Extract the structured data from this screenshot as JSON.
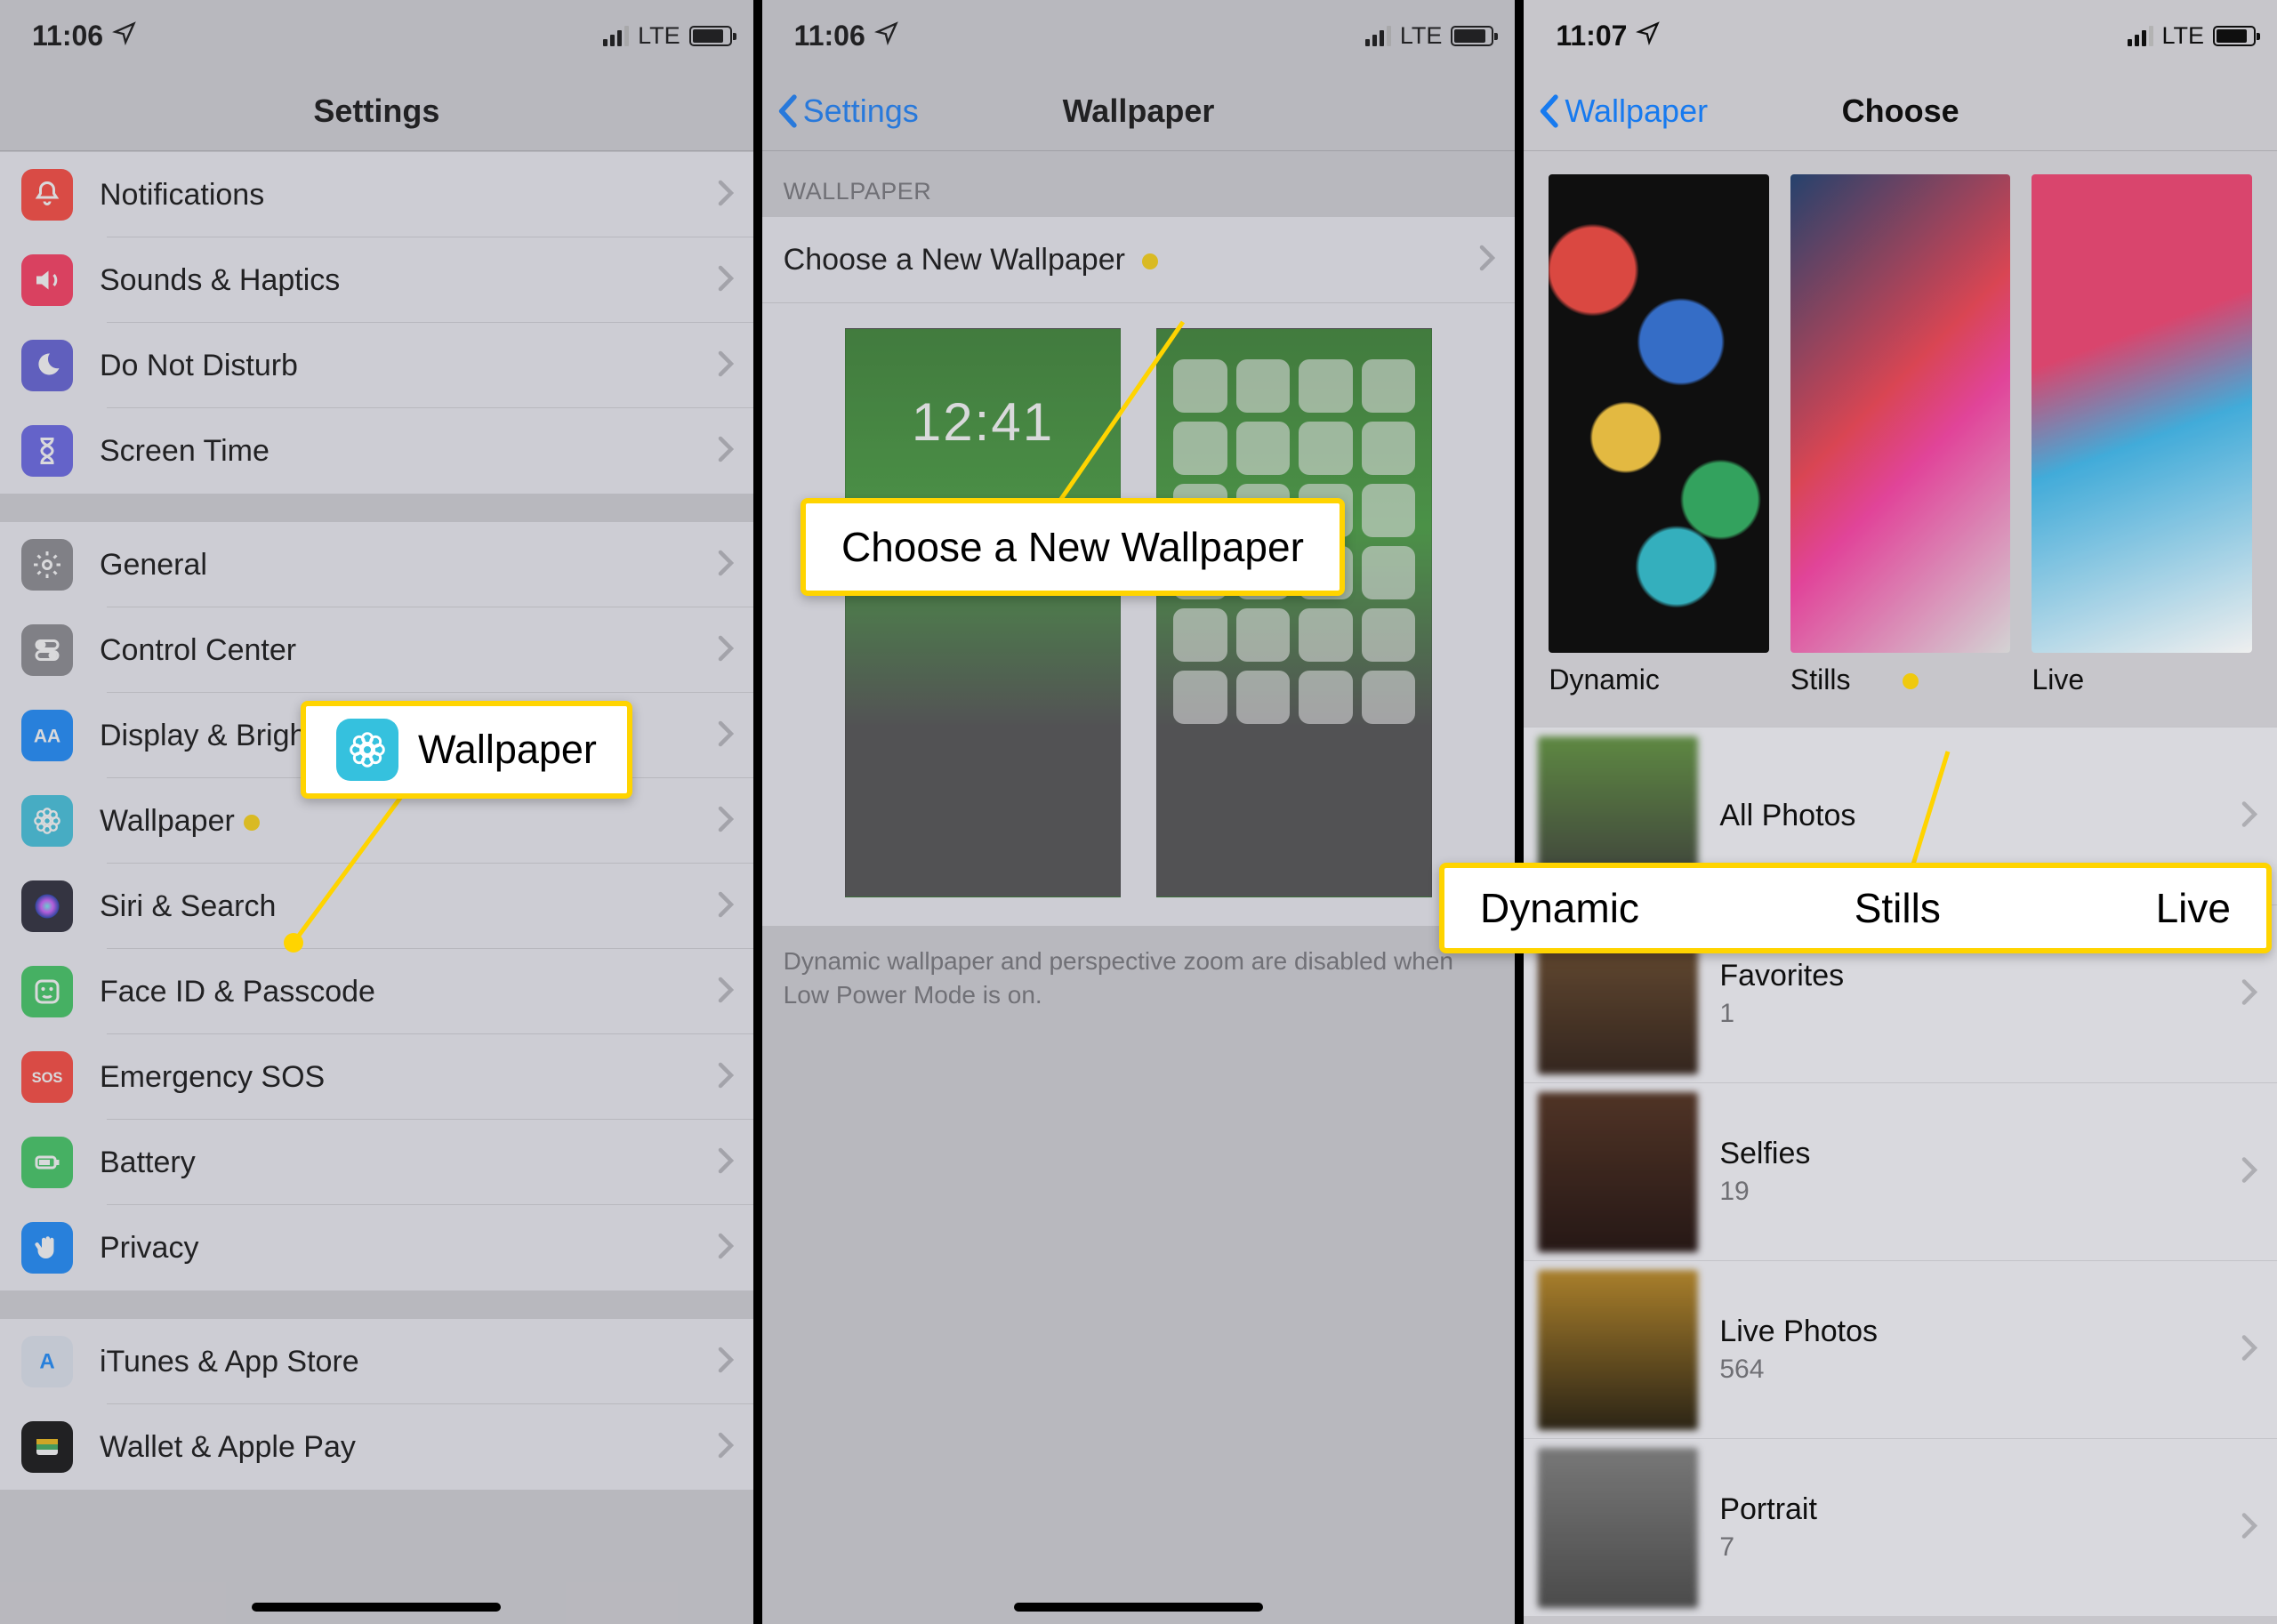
{
  "status": {
    "time1": "11:06",
    "time2": "11:06",
    "time3": "11:07",
    "net": "LTE"
  },
  "screen1": {
    "title": "Settings",
    "groups": [
      [
        {
          "id": "notifications",
          "label": "Notifications",
          "icon": "bell",
          "bg": "bg-red"
        },
        {
          "id": "sounds",
          "label": "Sounds & Haptics",
          "icon": "speaker",
          "bg": "bg-pink"
        },
        {
          "id": "dnd",
          "label": "Do Not Disturb",
          "icon": "moon",
          "bg": "bg-purple"
        },
        {
          "id": "screentime",
          "label": "Screen Time",
          "icon": "hourglass",
          "bg": "bg-indigo"
        }
      ],
      [
        {
          "id": "general",
          "label": "General",
          "icon": "gear",
          "bg": "bg-gray"
        },
        {
          "id": "control",
          "label": "Control Center",
          "icon": "switches",
          "bg": "bg-gray"
        },
        {
          "id": "display",
          "label": "Display & Brightness",
          "icon": "AA",
          "bg": "bg-blue"
        },
        {
          "id": "wallpaper",
          "label": "Wallpaper",
          "icon": "flower",
          "bg": "bg-cyan",
          "highlight": true
        },
        {
          "id": "siri",
          "label": "Siri & Search",
          "icon": "siri",
          "bg": "bg-dark"
        },
        {
          "id": "faceid",
          "label": "Face ID & Passcode",
          "icon": "face",
          "bg": "bg-green"
        },
        {
          "id": "sos",
          "label": "Emergency SOS",
          "icon": "SOS",
          "bg": "bg-sos"
        },
        {
          "id": "battery",
          "label": "Battery",
          "icon": "battery",
          "bg": "bg-batt"
        },
        {
          "id": "privacy",
          "label": "Privacy",
          "icon": "hand",
          "bg": "bg-hand"
        }
      ],
      [
        {
          "id": "itunes",
          "label": "iTunes & App Store",
          "icon": "A",
          "bg": "bg-cloud"
        },
        {
          "id": "wallet",
          "label": "Wallet & Apple Pay",
          "icon": "wallet",
          "bg": "bg-wallet"
        }
      ]
    ],
    "callout": "Wallpaper"
  },
  "screen2": {
    "back": "Settings",
    "title": "Wallpaper",
    "section": "WALLPAPER",
    "choose": "Choose a New Wallpaper",
    "footnote": "Dynamic wallpaper and perspective zoom are disabled when Low Power Mode is on.",
    "callout": "Choose a New Wallpaper"
  },
  "screen3": {
    "back": "Wallpaper",
    "title": "Choose",
    "cats": {
      "dynamic": "Dynamic",
      "stills": "Stills",
      "live": "Live"
    },
    "albums": [
      {
        "name": "All Photos",
        "count": ""
      },
      {
        "name": "Favorites",
        "count": "1"
      },
      {
        "name": "Selfies",
        "count": "19"
      },
      {
        "name": "Live Photos",
        "count": "564"
      },
      {
        "name": "Portrait",
        "count": "7"
      }
    ],
    "callout": {
      "a": "Dynamic",
      "b": "Stills",
      "c": "Live"
    }
  }
}
